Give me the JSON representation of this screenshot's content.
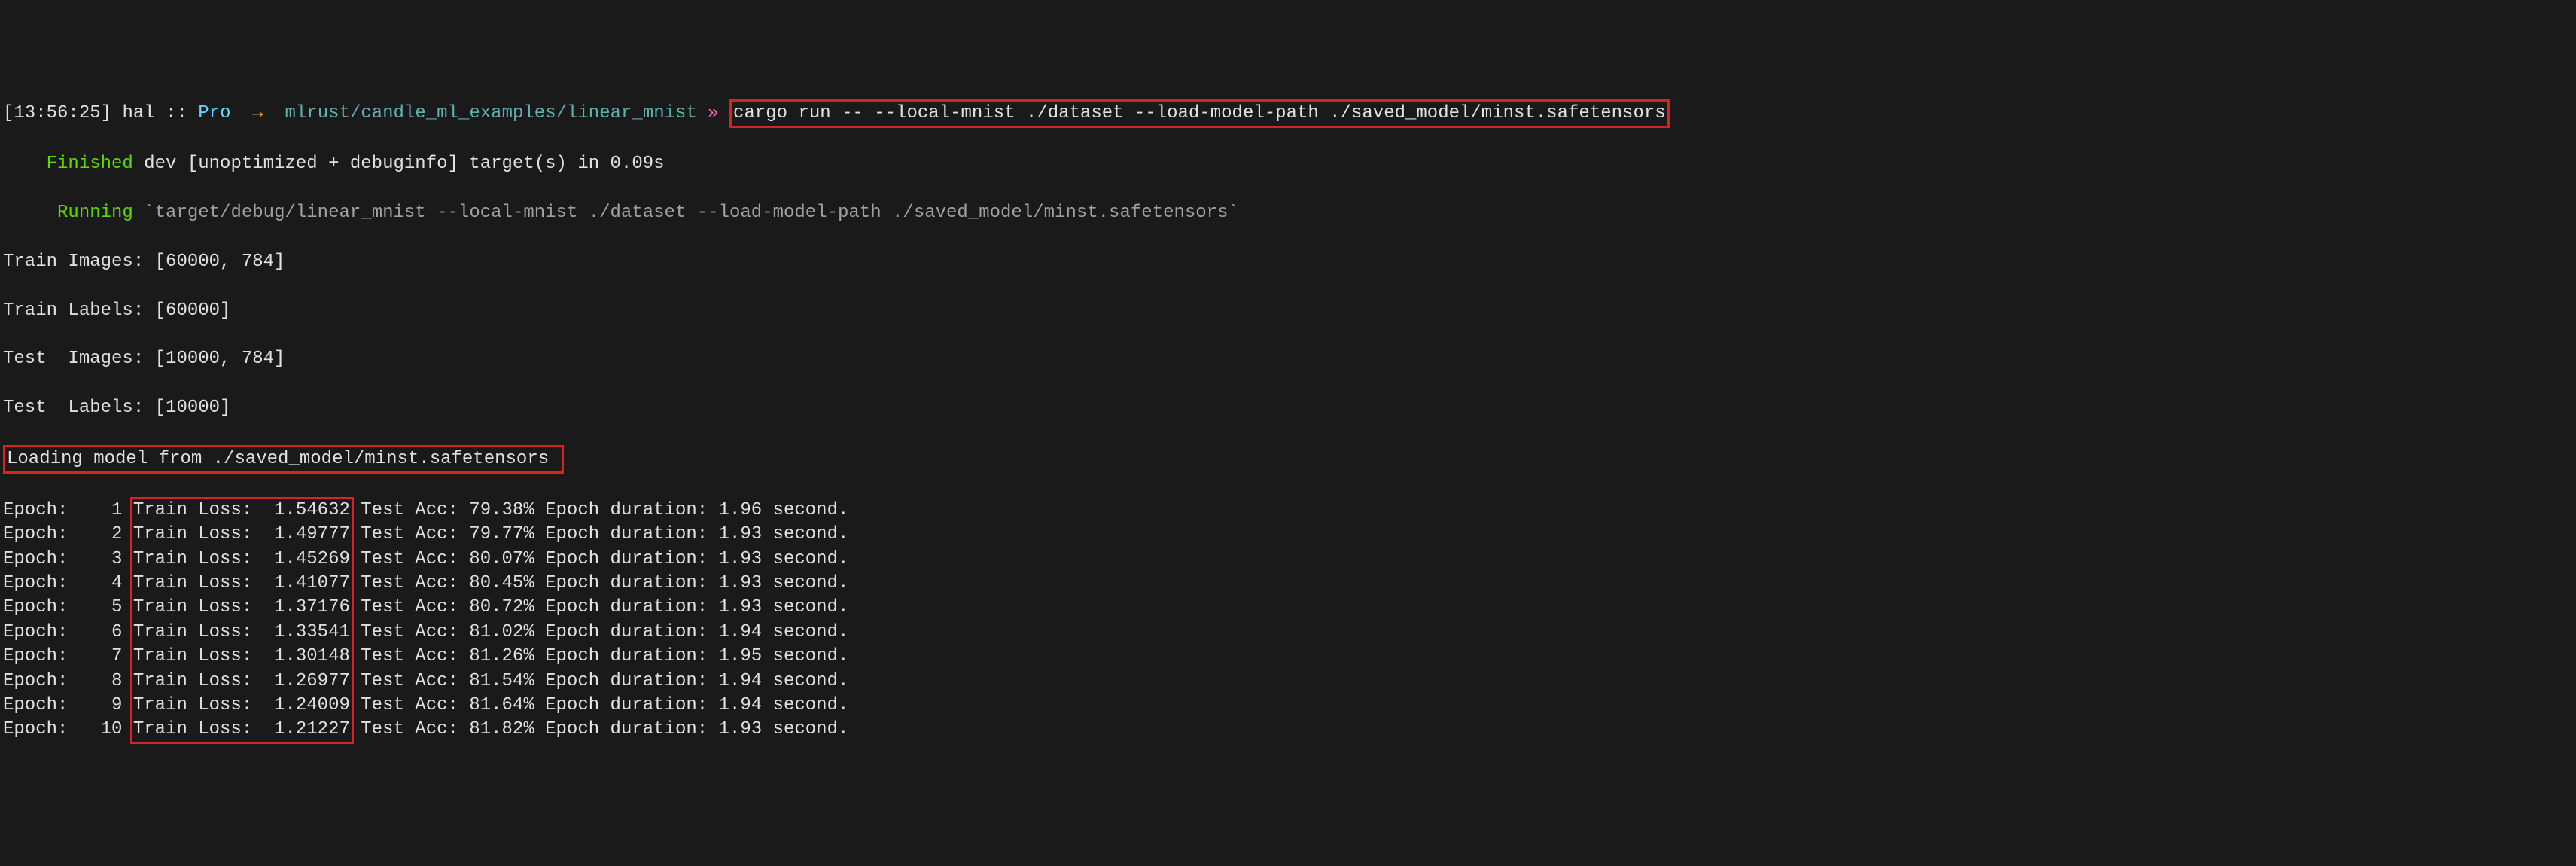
{
  "prompt": {
    "time": "[13:56:25]",
    "user": "hal",
    "sep": "::",
    "host": "Pro",
    "arrow": "→",
    "path": "mlrust/candle_ml_examples/linear_mnist",
    "symbol": "»",
    "command": "cargo run -- --local-mnist ./dataset --load-model-path ./saved_model/minst.safetensors"
  },
  "build": {
    "finished_label": "Finished",
    "finished_rest": " dev [unoptimized + debuginfo] target(s) in 0.09s",
    "running_label": "Running",
    "running_rest": " `target/debug/linear_mnist --local-mnist ./dataset --load-model-path ./saved_model/minst.safetensors`"
  },
  "shapes": {
    "train_images": "Train Images: [60000, 784]",
    "train_labels": "Train Labels: [60000]",
    "test_images": "Test  Images: [10000, 784]",
    "test_labels": "Test  Labels: [10000]"
  },
  "loading_msg": "Loading model from ./saved_model/minst.safetensors",
  "epoch_label": "Epoch:",
  "trainloss_label": "Train Loss:",
  "testacc_label": "Test Acc:",
  "duration_label": "Epoch duration:",
  "second_label": "second.",
  "epochs": [
    {
      "n": "1",
      "loss": "1.54632",
      "acc": "79.38%",
      "dur": "1.96"
    },
    {
      "n": "2",
      "loss": "1.49777",
      "acc": "79.77%",
      "dur": "1.93"
    },
    {
      "n": "3",
      "loss": "1.45269",
      "acc": "80.07%",
      "dur": "1.93"
    },
    {
      "n": "4",
      "loss": "1.41077",
      "acc": "80.45%",
      "dur": "1.93"
    },
    {
      "n": "5",
      "loss": "1.37176",
      "acc": "80.72%",
      "dur": "1.93"
    },
    {
      "n": "6",
      "loss": "1.33541",
      "acc": "81.02%",
      "dur": "1.94"
    },
    {
      "n": "7",
      "loss": "1.30148",
      "acc": "81.26%",
      "dur": "1.95"
    },
    {
      "n": "8",
      "loss": "1.26977",
      "acc": "81.54%",
      "dur": "1.94"
    },
    {
      "n": "9",
      "loss": "1.24009",
      "acc": "81.64%",
      "dur": "1.94"
    },
    {
      "n": "10",
      "loss": "1.21227",
      "acc": "81.82%",
      "dur": "1.93"
    }
  ],
  "chart_data": {
    "type": "table",
    "title": "Training log",
    "columns": [
      "Epoch",
      "Train Loss",
      "Test Acc (%)",
      "Epoch duration (s)"
    ],
    "rows": [
      [
        1,
        1.54632,
        79.38,
        1.96
      ],
      [
        2,
        1.49777,
        79.77,
        1.93
      ],
      [
        3,
        1.45269,
        80.07,
        1.93
      ],
      [
        4,
        1.41077,
        80.45,
        1.93
      ],
      [
        5,
        1.37176,
        80.72,
        1.93
      ],
      [
        6,
        1.33541,
        81.02,
        1.94
      ],
      [
        7,
        1.30148,
        81.26,
        1.95
      ],
      [
        8,
        1.26977,
        81.54,
        1.94
      ],
      [
        9,
        1.24009,
        81.64,
        1.94
      ],
      [
        10,
        1.21227,
        81.82,
        1.93
      ]
    ]
  }
}
